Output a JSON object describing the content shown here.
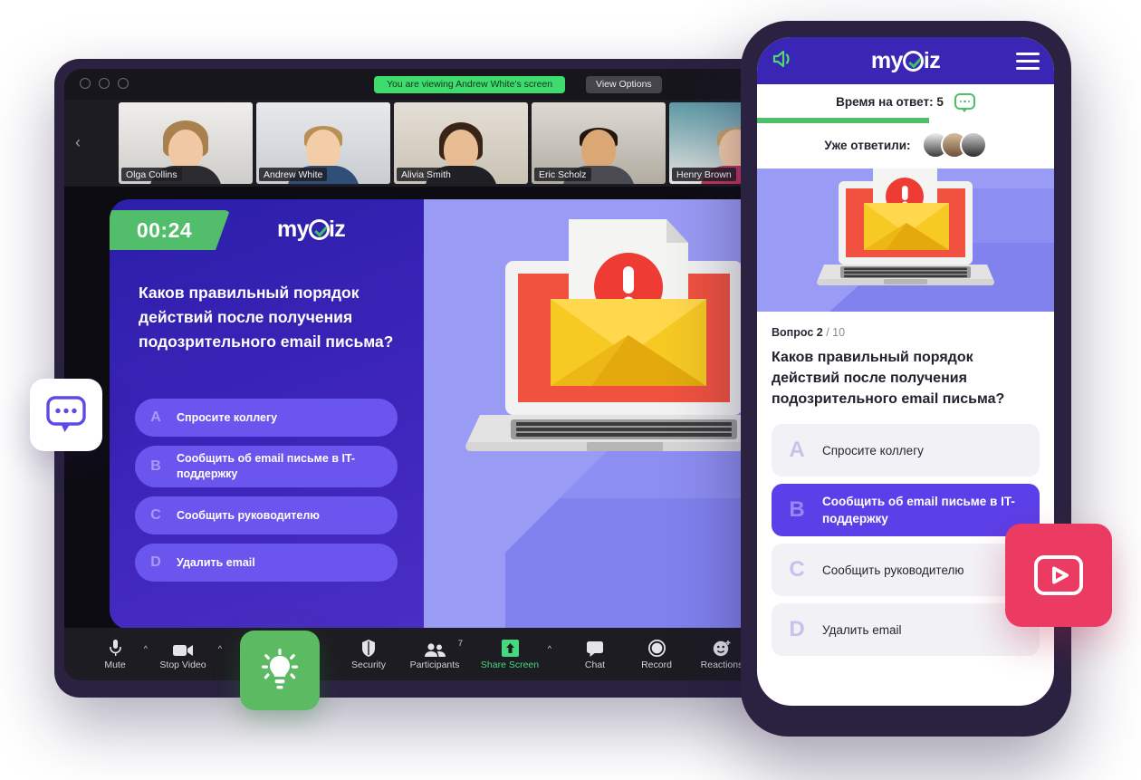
{
  "zoom_window": {
    "banner": "You are viewing Andrew White's screen",
    "view_options": "View Options",
    "participants": [
      {
        "name": "Olga Collins",
        "active": false
      },
      {
        "name": "Andrew White",
        "active": true
      },
      {
        "name": "Alivia Smith",
        "active": false
      },
      {
        "name": "Eric Scholz",
        "active": false
      },
      {
        "name": "Henry Brown",
        "active": false
      }
    ],
    "toolbar": [
      {
        "label": "Mute",
        "icon": "microphone-icon",
        "caret": true,
        "green": false,
        "badge": ""
      },
      {
        "label": "Stop Video",
        "icon": "video-camera-icon",
        "caret": true,
        "green": false,
        "badge": ""
      },
      {
        "label": "Security",
        "icon": "shield-icon",
        "caret": false,
        "green": false,
        "badge": ""
      },
      {
        "label": "Participants",
        "icon": "people-icon",
        "caret": false,
        "green": false,
        "badge": "7"
      },
      {
        "label": "Share Screen",
        "icon": "share-screen-icon",
        "caret": true,
        "green": true,
        "badge": ""
      },
      {
        "label": "Chat",
        "icon": "chat-bubble-icon",
        "caret": false,
        "green": false,
        "badge": ""
      },
      {
        "label": "Record",
        "icon": "record-circle-icon",
        "caret": false,
        "green": false,
        "badge": ""
      },
      {
        "label": "Reactions",
        "icon": "smiley-plus-icon",
        "caret": false,
        "green": false,
        "badge": ""
      }
    ]
  },
  "slide": {
    "timer": "00:24",
    "brand": "my",
    "brand_tail": "iz",
    "question": "Каков правильный порядок действий после получения подозрительного  email письма?",
    "answers": [
      {
        "letter": "A",
        "text": "Спросите коллегу"
      },
      {
        "letter": "B",
        "text": "Сообщить об email письме в IT-поддержку"
      },
      {
        "letter": "C",
        "text": "Сообщить руководителю"
      },
      {
        "letter": "D",
        "text": "Удалить email"
      }
    ]
  },
  "phone": {
    "brand": "my",
    "brand_tail": "iz",
    "time_label": "Время на ответ: 5",
    "answered_label": "Уже ответили:",
    "progress_percent": 58,
    "question_number_label": "Вопрос 2",
    "question_total_label": "/ 10",
    "question": "Каков правильный порядок действий после получения подозрительного  email письма?",
    "answers": [
      {
        "letter": "A",
        "text": "Спросите коллегу",
        "selected": false
      },
      {
        "letter": "B",
        "text": "Сообщить об email письме в IT-поддержку",
        "selected": true
      },
      {
        "letter": "C",
        "text": "Сообщить руководителю",
        "selected": false
      },
      {
        "letter": "D",
        "text": "Удалить email",
        "selected": false
      }
    ]
  },
  "floating": {
    "chat_icon": "chat-bubble-dots-icon",
    "video_icon": "video-play-icon",
    "bulb_icon": "lightbulb-icon"
  },
  "colors": {
    "brand_purple": "#3a26b5",
    "slide_purple": "#3a23b8",
    "answer_purple": "#6a56ee",
    "selected_purple": "#5b3fe8",
    "accent_green": "#52bd6a",
    "zoom_green": "#3ddc6c",
    "video_pink": "#ec3b63",
    "light_purple": "#9a9bf4",
    "frame_dark": "#2a2240"
  }
}
